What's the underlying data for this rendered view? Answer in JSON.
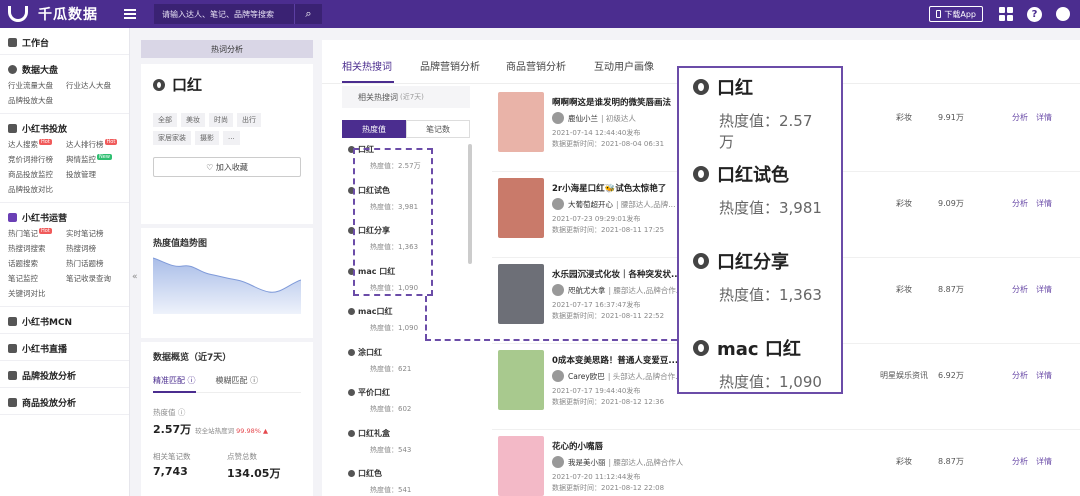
{
  "app": {
    "name": "千瓜数据"
  },
  "search": {
    "placeholder": "请输入达人、笔记、品牌等搜索"
  },
  "topbar": {
    "download": "下载App"
  },
  "sidebar": {
    "groups": [
      {
        "title": "工作台",
        "items": []
      },
      {
        "title": "数据大盘",
        "items": [
          "行业流量大盘",
          "行业达人大盘",
          "品牌投放大盘"
        ]
      },
      {
        "title": "小红书投放",
        "items": [
          "达人搜索",
          "达人排行榜",
          "竞价词排行榜",
          "舆情监控",
          "商品投放监控",
          "投放管理",
          "品牌投放对比"
        ]
      },
      {
        "title": "小红书运营",
        "items": [
          "热门笔记",
          "实时笔记榜",
          "热搜词搜索",
          "热搜词榜",
          "话题搜索",
          "热门话题榜",
          "笔记监控",
          "笔记收录查询",
          "关键词对比"
        ]
      },
      {
        "title": "小红书MCN",
        "items": []
      },
      {
        "title": "小红书直播",
        "items": []
      },
      {
        "title": "品牌投放分析",
        "items": []
      },
      {
        "title": "商品投放分析",
        "items": []
      }
    ],
    "badges": {
      "hot": "Hot",
      "new": "New"
    },
    "collapse": "«"
  },
  "panel": {
    "header": "热词分析",
    "keyword": "口红",
    "chips": [
      "全部",
      "美妆",
      "时尚",
      "出行",
      "家居家装",
      "摄影",
      "..."
    ],
    "collect": "♡ 加入收藏",
    "trend_title": "热度值趋势图",
    "stats_title": "数据概览（近7天）",
    "match_exact": "精准匹配 ⓘ",
    "match_fuzzy": "模糊匹配 ⓘ",
    "heat_label": "热度值 ⓘ",
    "heat_value": "2.57万",
    "heat_sub": "较全站热度词",
    "heat_pct": "99.98% ▲",
    "notes_label": "相关笔记数",
    "notes_value": "7,743",
    "likes_label": "点赞总数",
    "likes_value": "134.05万"
  },
  "tabs": [
    "相关热搜词",
    "品牌营销分析",
    "商品营销分析",
    "互动用户画像"
  ],
  "related": {
    "label": "相关热搜词",
    "sub": "(近7天)"
  },
  "list_tabs": [
    "热度值",
    "笔记数"
  ],
  "keywords": [
    {
      "name": "口红",
      "heat": "热度值：2.57万"
    },
    {
      "name": "口红试色",
      "heat": "热度值：3,981"
    },
    {
      "name": "口红分享",
      "heat": "热度值：1,363"
    },
    {
      "name": "mac 口红",
      "heat": "热度值：1,090"
    },
    {
      "name": "mac口红",
      "heat": "热度值：1,090"
    },
    {
      "name": "涂口红",
      "heat": "热度值：621"
    },
    {
      "name": "平价口红",
      "heat": "热度值：602"
    },
    {
      "name": "口红礼盒",
      "heat": "热度值：543"
    },
    {
      "name": "口红色",
      "heat": "热度值：541"
    }
  ],
  "notes": [
    {
      "title": "啊啊啊这是谁发明的微笑唇画法",
      "author": "鹿仙小兰",
      "tag": "| 初级达人",
      "pub": "2021-07-14 12:44:40发布",
      "upd": "数据更新时间：2021-08-04 06:31",
      "cat": "彩妆",
      "fav": "9.91万",
      "color": "#e9b3a8"
    },
    {
      "title": "2r小海星口红🐝试色太惊艳了",
      "author": "大葡萄超开心",
      "tag": "| 腰部达人,品牌...",
      "pub": "2021-07-23 09:29:01发布",
      "upd": "数据更新时间：2021-08-11 17:25",
      "cat": "彩妆",
      "fav": "9.09万",
      "color": "#c97a6a"
    },
    {
      "title": "水乐园沉浸式化妆｜各种突发状...",
      "author": "咫航尤大拿",
      "tag": "| 腰部达人,品牌合作...",
      "pub": "2021-07-17 16:37:47发布",
      "upd": "数据更新时间：2021-08-11 22:52",
      "cat": "彩妆",
      "fav": "8.87万",
      "color": "#6d6f77"
    },
    {
      "title": "0成本变美思路！普通人变爱豆...",
      "author": "Carey欧巴",
      "tag": "| 头部达人,品牌合作...",
      "pub": "2021-07-17 19:44:40发布",
      "upd": "数据更新时间：2021-08-12 12:36",
      "cat": "明星娱乐资讯",
      "fav": "6.92万",
      "color": "#a8c98e"
    },
    {
      "title": "花心的小嘴唇",
      "author": "我是美小丽",
      "tag": "| 腰部达人,品牌合作人",
      "pub": "2021-07-20 11:12:44发布",
      "upd": "数据更新时间：2021-08-12 22:08",
      "cat": "彩妆",
      "fav": "8.87万",
      "color": "#f3b9c7"
    }
  ],
  "actions": {
    "analyze": "分析",
    "detail": "详情"
  },
  "callout": [
    {
      "name": "口红",
      "heat": "热度值：2.57万"
    },
    {
      "name": "口红试色",
      "heat": "热度值：3,981"
    },
    {
      "name": "口红分享",
      "heat": "热度值：1,363"
    },
    {
      "name": "mac 口红",
      "heat": "热度值：1,090"
    }
  ],
  "colors": {
    "brand": "#4b2d8f",
    "accent": "#6b4ca8",
    "up": "#e5484d"
  }
}
